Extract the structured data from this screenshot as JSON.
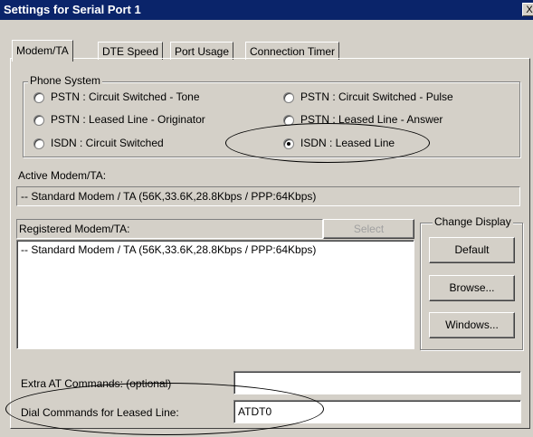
{
  "window": {
    "title": "Settings for Serial Port 1",
    "close_glyph": "X"
  },
  "tabs": [
    {
      "label": "Modem/TA",
      "active": true
    },
    {
      "label": "DTE Speed",
      "active": false
    },
    {
      "label": "Port Usage",
      "active": false
    },
    {
      "label": "Connection Timer",
      "active": false
    }
  ],
  "phone_system": {
    "label": "Phone System",
    "options": [
      {
        "label": "PSTN : Circuit Switched - Tone",
        "checked": false
      },
      {
        "label": "PSTN : Circuit Switched - Pulse",
        "checked": false
      },
      {
        "label": "PSTN : Leased Line - Originator",
        "checked": false
      },
      {
        "label": "PSTN : Leased Line - Answer",
        "checked": false
      },
      {
        "label": "ISDN : Circuit Switched",
        "checked": false
      },
      {
        "label": "ISDN : Leased Line",
        "checked": true
      }
    ]
  },
  "active_modem": {
    "label": "Active Modem/TA:",
    "value": "-- Standard Modem / TA (56K,33.6K,28.8Kbps / PPP:64Kbps)"
  },
  "registered_modem": {
    "label": "Registered Modem/TA:",
    "select_label": "Select",
    "items": [
      "-- Standard Modem / TA (56K,33.6K,28.8Kbps / PPP:64Kbps)"
    ]
  },
  "change_display": {
    "label": "Change Display",
    "buttons": [
      "Default",
      "Browse...",
      "Windows..."
    ]
  },
  "extra_at": {
    "label": "Extra AT Commands: (optional)",
    "value": ""
  },
  "dial_commands": {
    "label": "Dial Commands for Leased Line:",
    "value": "ATDT0"
  }
}
